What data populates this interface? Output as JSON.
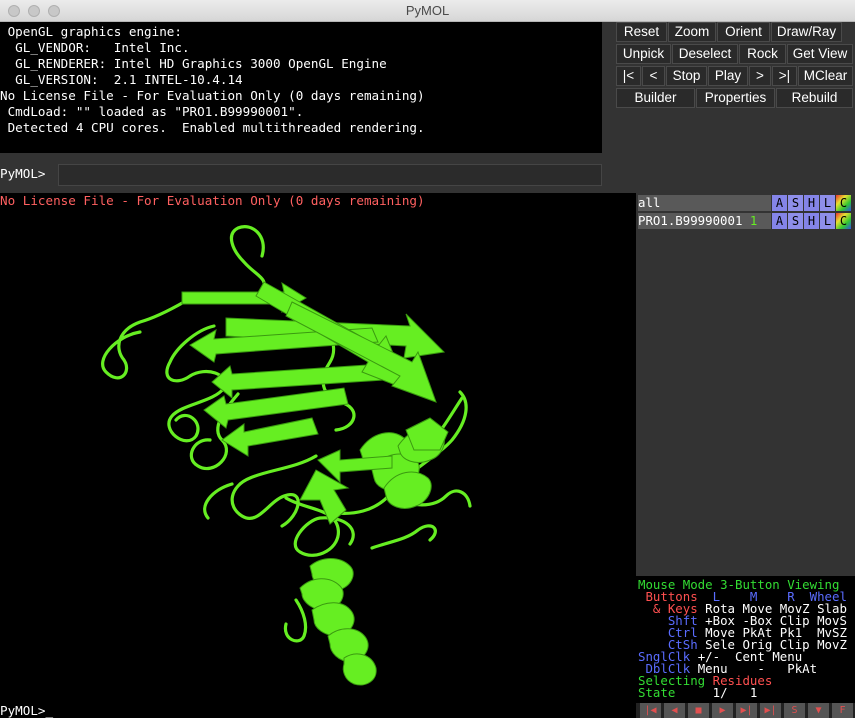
{
  "window": {
    "title": "PyMOL"
  },
  "console": {
    "lines": [
      " OpenGL graphics engine:",
      "  GL_VENDOR:   Intel Inc.",
      "  GL_RENDERER: Intel HD Graphics 3000 OpenGL Engine",
      "  GL_VERSION:  2.1 INTEL-10.4.14",
      "No License File - For Evaluation Only (0 days remaining)",
      " CmdLoad: \"\" loaded as \"PRO1.B99990001\".",
      " Detected 4 CPU cores.  Enabled multithreaded rendering."
    ]
  },
  "command": {
    "prompt": "PyMOL>",
    "value": ""
  },
  "buttons": {
    "row1": [
      "Reset",
      "Zoom",
      "Orient",
      "Draw/Ray"
    ],
    "row2": [
      "Unpick",
      "Deselect",
      "Rock",
      "Get View"
    ],
    "row3": [
      "|<",
      "<",
      "Stop",
      "Play",
      ">",
      ">|",
      "MClear"
    ],
    "row4": [
      "Builder",
      "Properties",
      "Rebuild"
    ]
  },
  "viewer": {
    "license_text": "No License File - For Evaluation Only (0 days remaining)",
    "cartoon_color": "#66ee22"
  },
  "objects": [
    {
      "name": "all",
      "state": "",
      "buttons": [
        "A",
        "S",
        "H",
        "L",
        "C"
      ]
    },
    {
      "name": "PRO1.B99990001",
      "state": "1",
      "buttons": [
        "A",
        "S",
        "H",
        "L",
        "C"
      ]
    }
  ],
  "mouse_panel": {
    "mode_label": "Mouse Mode",
    "mode_value": "3-Button Viewing",
    "buttons_label": "Buttons",
    "cols": [
      "L",
      "M",
      "R",
      "Wheel"
    ],
    "rows": [
      {
        "key": "& Keys",
        "vals": [
          "Rota",
          "Move",
          "MovZ",
          "Slab"
        ]
      },
      {
        "key": "Shft",
        "vals": [
          "+Box",
          "-Box",
          "Clip",
          "MovS"
        ]
      },
      {
        "key": "Ctrl",
        "vals": [
          "Move",
          "PkAt",
          "Pk1",
          "MvSZ"
        ]
      },
      {
        "key": "CtSh",
        "vals": [
          "Sele",
          "Orig",
          "Clip",
          "MovZ"
        ]
      },
      {
        "key": "SnglClk",
        "vals": [
          "+/-",
          "Cent",
          "Menu",
          ""
        ]
      },
      {
        "key": "DblClk",
        "vals": [
          "Menu",
          "-",
          "PkAt",
          ""
        ]
      }
    ],
    "selecting_label": "Selecting",
    "selecting_value": "Residues",
    "state_label": "State",
    "state_value": "1/   1"
  },
  "bottom_prompt": "PyMOL>_",
  "movie_controls": [
    "|◀",
    "◀",
    "■",
    "▶",
    "▶|",
    "▶|",
    "S",
    "▼",
    "F"
  ],
  "colors": {
    "console_bg": "#000000",
    "panel_bg": "#333333",
    "license_red": "#ff6060",
    "mouse_mode_green": "#33dd33",
    "mouse_key_blue": "#5a6cff",
    "mouse_key_red": "#ff5050"
  }
}
